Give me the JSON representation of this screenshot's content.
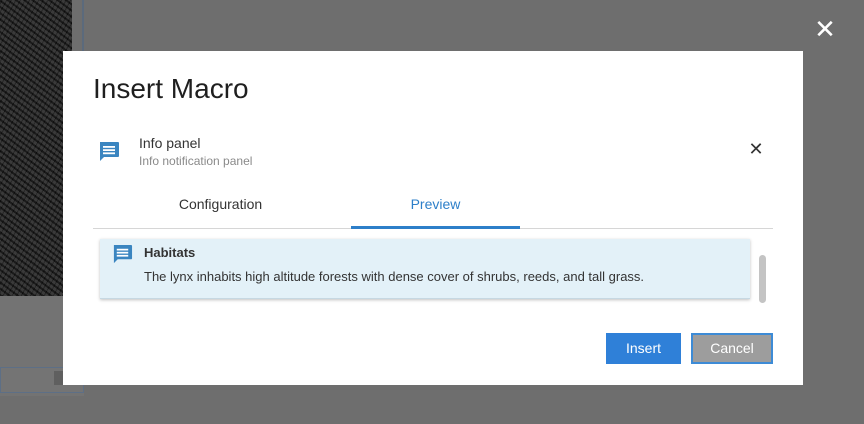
{
  "dialog": {
    "title": "Insert Macro",
    "close_label": "✕"
  },
  "macro": {
    "name": "Info panel",
    "description": "Info notification panel",
    "icon": "message-icon",
    "remove_label": "✕"
  },
  "tabs": [
    {
      "label": "Configuration",
      "active": false
    },
    {
      "label": "Preview",
      "active": true
    }
  ],
  "preview": {
    "panel_title": "Habitats",
    "panel_text": "The lynx inhabits high altitude forests with dense cover of shrubs, reeds, and tall grass.",
    "background_color": "#e3f1f8"
  },
  "buttons": {
    "insert": "Insert",
    "cancel": "Cancel"
  },
  "colors": {
    "accent": "#2d7fc9",
    "icon": "#3a85c0"
  }
}
